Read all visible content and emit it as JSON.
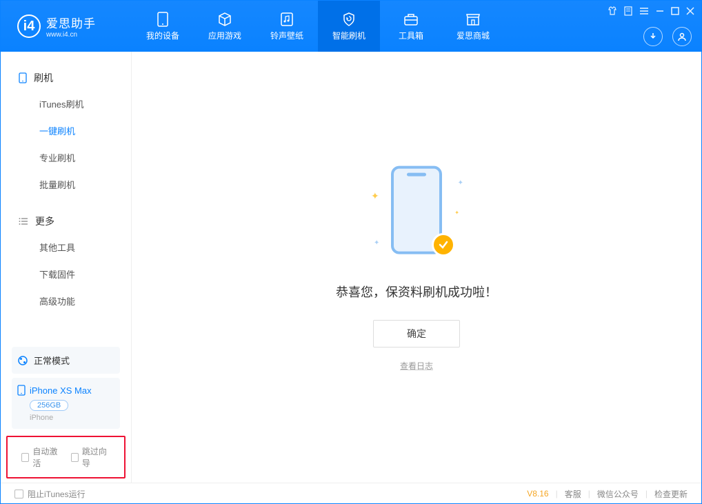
{
  "app": {
    "title": "爱思助手",
    "subtitle": "www.i4.cn"
  },
  "nav": {
    "tabs": [
      {
        "label": "我的设备",
        "icon": "device"
      },
      {
        "label": "应用游戏",
        "icon": "cube"
      },
      {
        "label": "铃声壁纸",
        "icon": "music"
      },
      {
        "label": "智能刷机",
        "icon": "shield",
        "active": true
      },
      {
        "label": "工具箱",
        "icon": "toolbox"
      },
      {
        "label": "爱思商城",
        "icon": "store"
      }
    ]
  },
  "sidebar": {
    "group1": {
      "title": "刷机",
      "items": [
        "iTunes刷机",
        "一键刷机",
        "专业刷机",
        "批量刷机"
      ],
      "activeIndex": 1
    },
    "group2": {
      "title": "更多",
      "items": [
        "其他工具",
        "下载固件",
        "高级功能"
      ]
    },
    "mode_label": "正常模式",
    "device": {
      "name": "iPhone XS Max",
      "storage": "256GB",
      "type": "iPhone"
    },
    "checks": {
      "auto_activate": "自动激活",
      "skip_guide": "跳过向导"
    }
  },
  "main": {
    "success_msg": "恭喜您，保资料刷机成功啦！",
    "ok_button": "确定",
    "view_log": "查看日志"
  },
  "statusbar": {
    "block_itunes": "阻止iTunes运行",
    "version": "V8.16",
    "links": [
      "客服",
      "微信公众号",
      "检查更新"
    ]
  }
}
